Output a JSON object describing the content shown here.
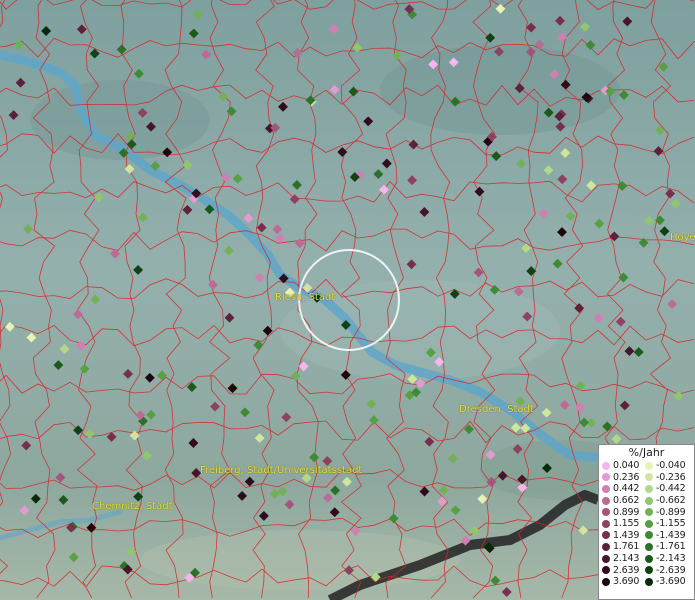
{
  "legend": {
    "title": "%/Jahr",
    "rows": [
      {
        "pos": "0.040",
        "neg": "-0.040",
        "pos_color": "#f4b6ec",
        "neg_color": "#e6f3b6"
      },
      {
        "pos": "0.236",
        "neg": "-0.236",
        "pos_color": "#e49ad0",
        "neg_color": "#cfe69c"
      },
      {
        "pos": "0.442",
        "neg": "-0.442",
        "pos_color": "#d07fb2",
        "neg_color": "#b3d888"
      },
      {
        "pos": "0.662",
        "neg": "-0.662",
        "pos_color": "#bd6a96",
        "neg_color": "#92c66e"
      },
      {
        "pos": "0.899",
        "neg": "-0.899",
        "pos_color": "#a4557c",
        "neg_color": "#73b158"
      },
      {
        "pos": "1.155",
        "neg": "-1.155",
        "pos_color": "#8d4262",
        "neg_color": "#58a044"
      },
      {
        "pos": "1.439",
        "neg": "-1.439",
        "pos_color": "#76304e",
        "neg_color": "#3f8a34"
      },
      {
        "pos": "1.761",
        "neg": "-1.761",
        "pos_color": "#5e213b",
        "neg_color": "#2b7228"
      },
      {
        "pos": "2.143",
        "neg": "-2.143",
        "pos_color": "#47162a",
        "neg_color": "#1c5a1c"
      },
      {
        "pos": "2.639",
        "neg": "-2.639",
        "pos_color": "#310c1c",
        "neg_color": "#104213"
      },
      {
        "pos": "3.690",
        "neg": "-3.690",
        "pos_color": "#1e0510",
        "neg_color": "#062a0a"
      }
    ]
  },
  "cities": [
    {
      "name": "Riesa, Stadt"
    },
    {
      "name": "Dresden, Stadt"
    },
    {
      "name": "Freiberg, Stadt/Universitätsstadt"
    },
    {
      "name": "Chemnitz, Stadt"
    },
    {
      "name": "Hoye"
    }
  ],
  "colors": {
    "background": "#8fa8a6",
    "river": "#5fa6c9",
    "borders": "#d8262a",
    "highlight_ring": "#ffffff"
  },
  "markers": [
    {
      "c": 1,
      "lvl": 3
    },
    {
      "c": 0,
      "lvl": 0
    },
    {
      "c": 1,
      "lvl": 9
    },
    {
      "c": 0,
      "lvl": 5
    },
    {
      "c": 1,
      "lvl": 6
    },
    {
      "c": 0,
      "lvl": 2
    },
    {
      "c": 1,
      "lvl": 1
    },
    {
      "c": 0,
      "lvl": 8
    },
    {
      "c": 1,
      "lvl": 4
    },
    {
      "c": 0,
      "lvl": 3
    },
    {
      "c": 1,
      "lvl": 7
    },
    {
      "c": 0,
      "lvl": 1
    },
    {
      "c": 1,
      "lvl": 2
    },
    {
      "c": 0,
      "lvl": 6
    },
    {
      "c": 1,
      "lvl": 5
    },
    {
      "c": 0,
      "lvl": 4
    },
    {
      "c": 1,
      "lvl": 10
    },
    {
      "c": 0,
      "lvl": 0
    },
    {
      "c": 1,
      "lvl": 3
    },
    {
      "c": 0,
      "lvl": 7
    },
    {
      "c": 1,
      "lvl": 6
    },
    {
      "c": 0,
      "lvl": 2
    },
    {
      "c": 1,
      "lvl": 1
    },
    {
      "c": 0,
      "lvl": 9
    },
    {
      "c": 1,
      "lvl": 4
    }
  ]
}
